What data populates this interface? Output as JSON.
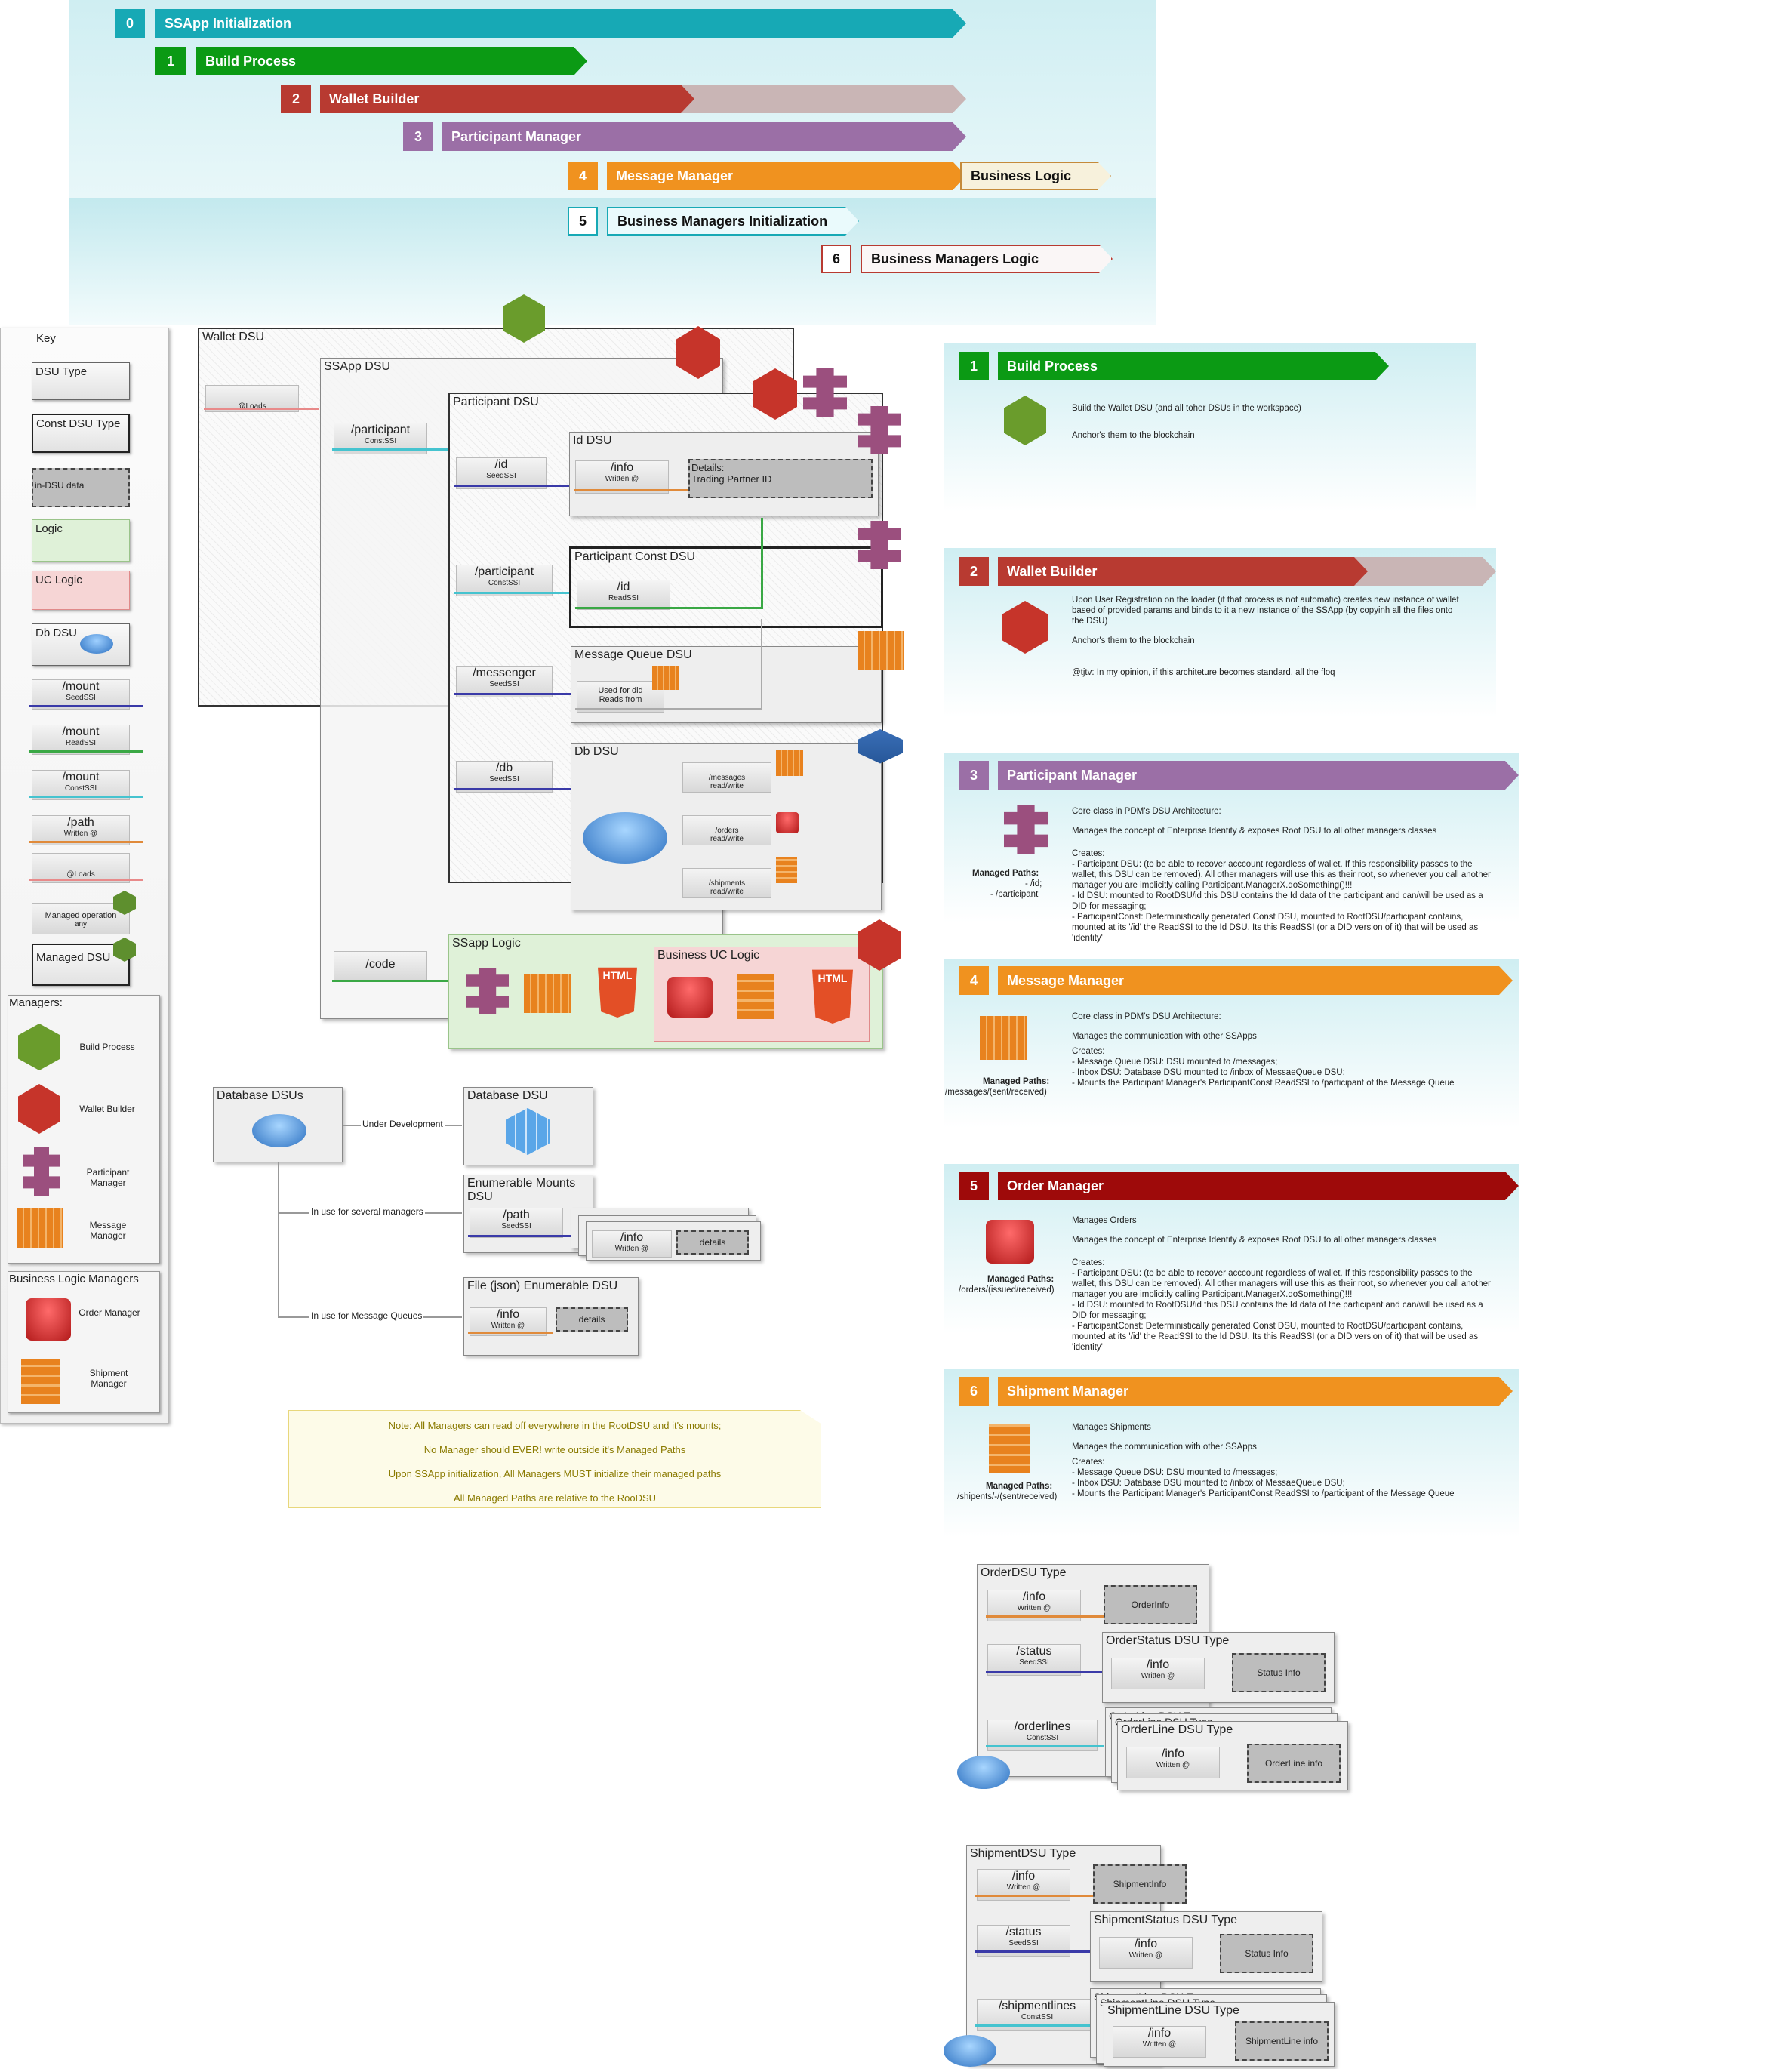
{
  "steps": [
    {
      "num": "0",
      "label": "SSApp Initialization",
      "color": "#17a9b5"
    },
    {
      "num": "1",
      "label": "Build Process",
      "color": "#0b9a14"
    },
    {
      "num": "2",
      "label": "Wallet Builder",
      "color": "#b83a31"
    },
    {
      "num": "3",
      "label": "Participant Manager",
      "color": "#9b6fa6"
    },
    {
      "num": "4",
      "label": "Message Manager",
      "color": "#f0921f"
    },
    {
      "num": "5",
      "label": "Business Managers Initialization",
      "color": "#ffffff"
    },
    {
      "num": "6",
      "label": "Business Managers Logic",
      "color": "#ffffff"
    }
  ],
  "business_logic_label": "Business Logic",
  "key": {
    "title": "Key",
    "items": [
      "DSU Type",
      "Const DSU Type",
      "in-DSU data",
      "Logic",
      "UC Logic",
      "Db DSU"
    ],
    "mounts": [
      {
        "path": "/mount",
        "sub": "SeedSSI"
      },
      {
        "path": "/mount",
        "sub": "ReadSSI"
      },
      {
        "path": "/mount",
        "sub": "ConstSSI"
      },
      {
        "path": "/path",
        "sub": "Written @"
      },
      {
        "path": "",
        "sub": "@Loads"
      }
    ],
    "managed_operation": "Managed operation",
    "managed_operation_sub": "any",
    "managed_dsu": "Managed DSU",
    "managers_title": "Managers:",
    "managers": [
      "Build Process",
      "Wallet Builder",
      "Participant Manager",
      "Message Manager"
    ],
    "business_title": "Business Logic Managers",
    "business_managers": [
      "Order Manager",
      "Shipment Manager"
    ]
  },
  "main": {
    "wallet_dsu": "Wallet DSU",
    "loads": "@Loads",
    "ssapp_dsu": "SSApp DSU",
    "participant_mount": {
      "path": "/participant",
      "sub": "ConstSSI"
    },
    "participant_dsu": "Participant DSU",
    "id_mount": {
      "path": "/id",
      "sub": "SeedSSI"
    },
    "id_dsu": "Id DSU",
    "info_mount": {
      "path": "/info",
      "sub": "Written @"
    },
    "details_label": "Details:",
    "details_value": "Trading Partner ID",
    "participant2_mount": {
      "path": "/participant",
      "sub": "ConstSSI"
    },
    "participant_const_dsu": "Participant Const DSU",
    "id2_mount": {
      "path": "/id",
      "sub": "ReadSSI"
    },
    "messenger_mount": {
      "path": "/messenger",
      "sub": "SeedSSI"
    },
    "message_queue_dsu": "Message Queue DSU",
    "used_for_did": "Used for did",
    "reads_from": "Reads from",
    "db_mount": {
      "path": "/db",
      "sub": "SeedSSI"
    },
    "db_dsu": "Db DSU",
    "db_items": [
      {
        "path": "/messages",
        "sub": "read/write"
      },
      {
        "path": "/orders",
        "sub": "read/write"
      },
      {
        "path": "/shipments",
        "sub": "read/write"
      }
    ],
    "code_mount": "/code",
    "ssapp_logic": "SSapp Logic",
    "business_uc_logic": "Business UC Logic",
    "html5": "HTML"
  },
  "database": {
    "dsus_title": "Database DSUs",
    "under_dev": "Under Development",
    "database_dsu": "Database DSU",
    "several_managers": "In use for several managers",
    "enumerable": "Enumerable Mounts DSU",
    "path_mount": {
      "path": "/path",
      "sub": "SeedSSI"
    },
    "info_mount": {
      "path": "/info",
      "sub": "Written @"
    },
    "details": "details",
    "message_queues": "In use for Message Queues",
    "file_enumerable": "File (json) Enumerable DSU"
  },
  "note": [
    "Note: All Managers can read off everywhere in the RootDSU and it's mounts;",
    "No Manager should EVER! write outside it's Managed Paths",
    "Upon SSApp initialization, All Managers MUST initialize their managed paths",
    "All Managed Paths are relative to the RooDSU"
  ],
  "panels": [
    {
      "num": "1",
      "title": "Build Process",
      "color": "#0b9a14",
      "lines": [
        "Build the Wallet DSU (and all toher DSUs in the workspace)",
        "Anchor's them to the blockchain"
      ]
    },
    {
      "num": "2",
      "title": "Wallet Builder",
      "color": "#b83a31",
      "lines": [
        "Upon User Registration on the loader (if that process is not automatic) creates new instance of wallet based of provided params and binds to it a new Instance of the SSApp (by copyinh all the files onto the DSU)",
        "Anchor's them to the blockchain",
        "@tjtv: In my opinion, if this architeture becomes standard, all the floq"
      ]
    },
    {
      "num": "3",
      "title": "Participant Manager",
      "color": "#9b6fa6",
      "managed_label": "Managed Paths:",
      "managed": [
        "- /id;",
        "- /participant"
      ],
      "lines": [
        "Core class in PDM's DSU Architecture:",
        "Manages the concept of Enterprise Identity & exposes Root DSU to all other managers classes",
        "Creates:",
        "- Participant DSU: (to be able to recover acccount regardless of wallet. If this responsibility passes to the wallet, this DSU can be removed). All other managers will use this as their root, so whenever you call another manager you are implicitly calling Participant.ManagerX.doSomething()!!!",
        "- Id DSU: mounted to RootDSU/id this DSU contains the Id data of the participant and can/will be used as a DID for messaging;",
        "- ParticipantConst: Deterministically generated Const DSU, mounted to RootDSU/participant contains, mounted at its '/id' the ReadSSI to the Id DSU. Its this ReadSSI (or a DID version of it) that will be used as 'identity'"
      ]
    },
    {
      "num": "4",
      "title": "Message Manager",
      "color": "#f0921f",
      "managed_label": "Managed Paths:",
      "managed": [
        "/messages/(sent/received)"
      ],
      "lines": [
        "Core class in PDM's DSU Architecture:",
        "Manages the communication with other SSApps",
        "Creates:",
        "- Message Queue DSU: DSU mounted to /messages;",
        "- Inbox DSU: Database DSU mounted to /inbox of MessaeQueue DSU;",
        "- Mounts the Participant Manager's ParticipantConst ReadSSI to /participant of the Message Queue"
      ]
    },
    {
      "num": "5",
      "title": "Order Manager",
      "color": "#9e0a0a",
      "managed_label": "Managed Paths:",
      "managed": [
        "/orders/(issued/received)"
      ],
      "lines": [
        "Manages Orders",
        "Manages the concept of Enterprise Identity & exposes Root DSU to all other managers classes",
        "Creates:",
        "- Participant DSU: (to be able to recover acccount regardless of wallet. If this responsibility passes to the wallet, this DSU can be removed). All other managers will use this as their root, so whenever you call another manager you are implicitly calling Participant.ManagerX.doSomething()!!!",
        "- Id DSU: mounted to RootDSU/id this DSU contains the Id data of the participant and can/will be used as a DID for messaging;",
        "- ParticipantConst: Deterministically generated Const DSU, mounted to RootDSU/participant contains, mounted at its '/id' the ReadSSI to the Id DSU. Its this ReadSSI (or a DID version of it) that will be used as 'identity'"
      ]
    },
    {
      "num": "6",
      "title": "Shipment Manager",
      "color": "#f0921f",
      "managed_label": "Managed Paths:",
      "managed": [
        "/shipents/-/(sent/received)"
      ],
      "lines": [
        "Manages Shipments",
        "Manages the communication with other SSApps",
        "Creates:",
        "- Message Queue DSU: DSU mounted to /messages;",
        "- Inbox DSU: Database DSU mounted to /inbox of MessaeQueue DSU;",
        "- Mounts the Participant Manager's ParticipantConst ReadSSI to /participant of the Message Queue"
      ]
    }
  ],
  "order_types": {
    "order_dsu": "OrderDSU Type",
    "info": {
      "path": "/info",
      "sub": "Written @"
    },
    "order_info": "OrderInfo",
    "status": {
      "path": "/status",
      "sub": "SeedSSI"
    },
    "order_status_dsu": "OrderStatus DSU Type",
    "status_info": "Status Info",
    "orderlines": {
      "path": "/orderlines",
      "sub": "ConstSSI"
    },
    "orderline_dsu": "OrderLine DSU Type",
    "orderline_info": "OrderLine info"
  },
  "shipment_types": {
    "shipment_dsu": "ShipmentDSU Type",
    "info": {
      "path": "/info",
      "sub": "Written @"
    },
    "shipment_info": "ShipmentInfo",
    "status": {
      "path": "/status",
      "sub": "SeedSSI"
    },
    "shipment_status_dsu": "ShipmentStatus DSU Type",
    "status_info": "Status Info",
    "shipmentlines": {
      "path": "/shipmentlines",
      "sub": "ConstSSI"
    },
    "shipmentline_dsu": "ShipmentLine DSU Type",
    "shipmentline_info": "ShipmentLine info"
  },
  "colors": {
    "seed": "#3a3aa8",
    "read": "#3aa845",
    "const": "#45c3cf",
    "written": "#e08a3a",
    "loads": "#e88a8a"
  }
}
